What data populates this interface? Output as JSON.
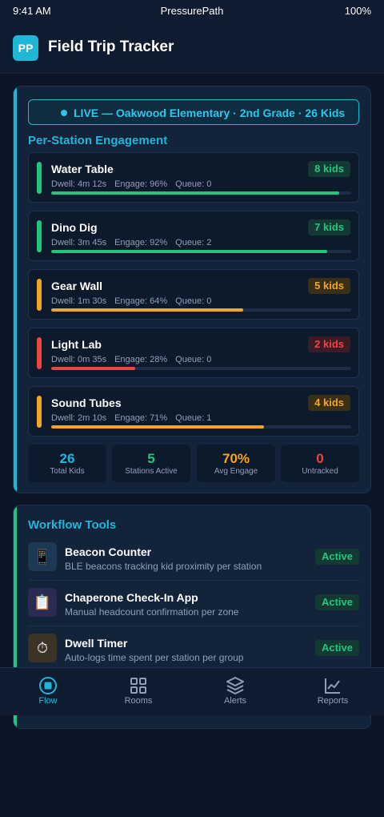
{
  "status_bar": {
    "time": "9:41 AM",
    "carrier": "PressurePath",
    "battery": "100%"
  },
  "header": {
    "logo": "PP",
    "title": "Field Trip Tracker"
  },
  "live": {
    "text": "LIVE — Oakwood Elementary · 2nd Grade · 26 Kids"
  },
  "engagement": {
    "title": "Per-Station Engagement",
    "stations": [
      {
        "name": "Water Table",
        "dwell": "Dwell: 4m 12s",
        "engage": "Engage: 96%",
        "queue": "Queue: 0",
        "kids": "8 kids",
        "level": 0.96,
        "color": "#22c57e"
      },
      {
        "name": "Dino Dig",
        "dwell": "Dwell: 3m 45s",
        "engage": "Engage: 92%",
        "queue": "Queue: 2",
        "kids": "7 kids",
        "level": 0.92,
        "color": "#22c57e"
      },
      {
        "name": "Gear Wall",
        "dwell": "Dwell: 1m 30s",
        "engage": "Engage: 64%",
        "queue": "Queue: 0",
        "kids": "5 kids",
        "level": 0.64,
        "color": "#f5a524"
      },
      {
        "name": "Light Lab",
        "dwell": "Dwell: 0m 35s",
        "engage": "Engage: 28%",
        "queue": "Queue: 0",
        "kids": "2 kids",
        "level": 0.28,
        "color": "#ef4444"
      },
      {
        "name": "Sound Tubes",
        "dwell": "Dwell: 2m 10s",
        "engage": "Engage: 71%",
        "queue": "Queue: 1",
        "kids": "4 kids",
        "level": 0.71,
        "color": "#f5a524"
      }
    ],
    "stats": [
      {
        "value": "26",
        "label": "Total Kids",
        "color": "#1fb6d8"
      },
      {
        "value": "5",
        "label": "Stations Active",
        "color": "#22c57e"
      },
      {
        "value": "70%",
        "label": "Avg Engage",
        "color": "#f5a524"
      },
      {
        "value": "0",
        "label": "Untracked",
        "color": "#ef4444"
      }
    ]
  },
  "workflow": {
    "title": "Workflow Tools",
    "tools": [
      {
        "icon": "phone-icon",
        "glyph": "📱",
        "name": "Beacon Counter",
        "desc": "BLE beacons tracking kid proximity per station",
        "status": "Active"
      },
      {
        "icon": "clipboard-icon",
        "glyph": "📋",
        "name": "Chaperone Check-In App",
        "desc": "Manual headcount confirmation per zone",
        "status": "Active"
      },
      {
        "icon": "timer-icon",
        "glyph": "⏱",
        "name": "Dwell Timer",
        "desc": "Auto-logs time spent per station per group",
        "status": "Active"
      }
    ]
  },
  "nav": {
    "items": [
      {
        "label": "Flow",
        "icon": "flow-icon",
        "active": true
      },
      {
        "label": "Rooms",
        "icon": "grid-icon",
        "active": false
      },
      {
        "label": "Alerts",
        "icon": "layers-icon",
        "active": false
      },
      {
        "label": "Reports",
        "icon": "chart-icon",
        "active": false
      }
    ]
  }
}
